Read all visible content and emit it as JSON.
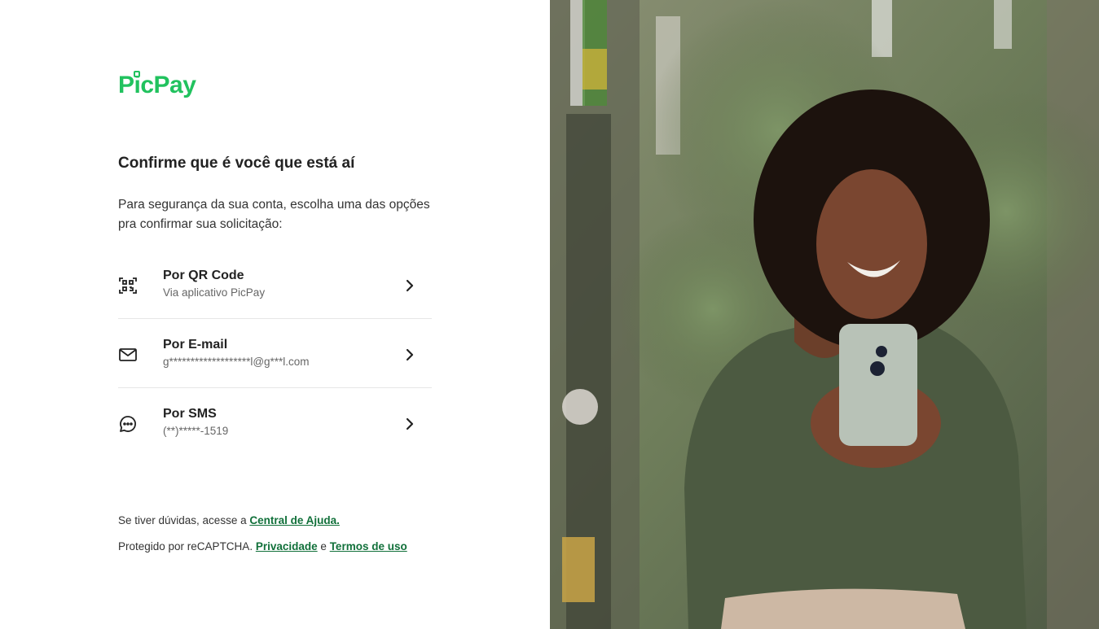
{
  "brand": {
    "name": "PicPay",
    "color": "#21c25e"
  },
  "header": {
    "title": "Confirme que é você que está aí",
    "description": "Para segurança da sua conta, escolha uma das opções pra confirmar sua solicitação:"
  },
  "options": [
    {
      "icon": "qr-code-icon",
      "title": "Por QR Code",
      "subtitle": "Via aplicativo PicPay"
    },
    {
      "icon": "mail-icon",
      "title": "Por E-mail",
      "subtitle": "g*******************l@g***l.com"
    },
    {
      "icon": "chat-icon",
      "title": "Por SMS",
      "subtitle": "(**)*****-1519"
    }
  ],
  "footer": {
    "help_prefix": "Se tiver dúvidas, acesse a",
    "help_link": "Central de Ajuda.",
    "recaptcha_prefix": "Protegido por reCAPTCHA.",
    "privacy_link": "Privacidade",
    "conjunction": "e",
    "terms_link": "Termos de uso"
  },
  "colors": {
    "link": "#11703a",
    "divider": "#e6e6e6"
  }
}
